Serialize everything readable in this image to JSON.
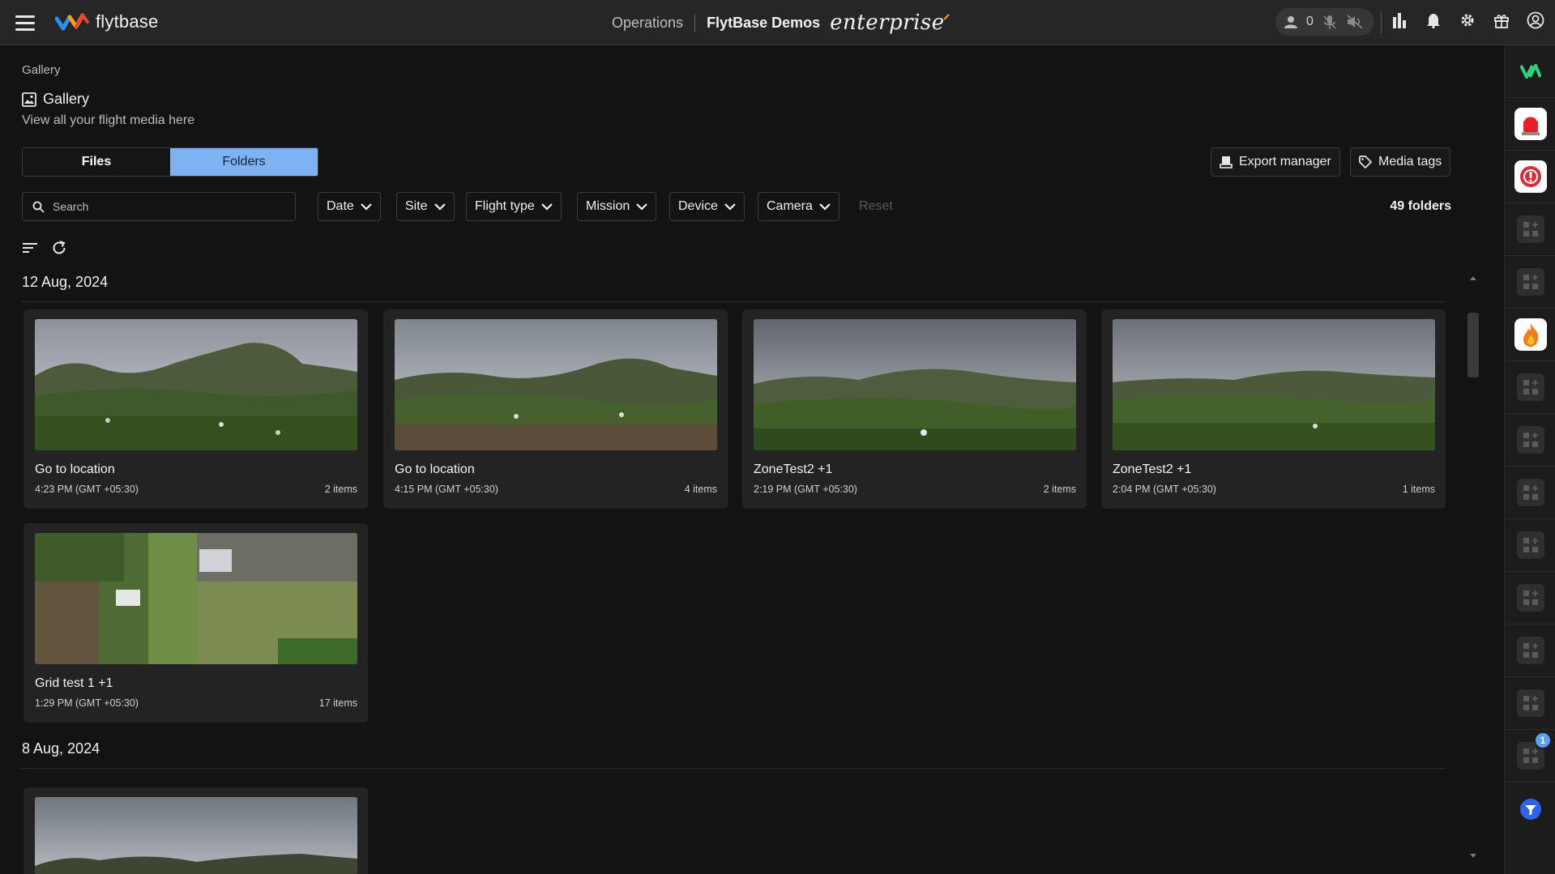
{
  "topbar": {
    "logo_text": "flytbase",
    "operations": "Operations",
    "org_name": "FlytBase Demos",
    "edition": "enterprise",
    "user_count": "0"
  },
  "page": {
    "breadcrumb": "Gallery",
    "title": "Gallery",
    "subtitle": "View all your flight media here"
  },
  "view_toggle": {
    "files": "Files",
    "folders": "Folders",
    "active": "Folders"
  },
  "actions": {
    "export_manager": "Export manager",
    "media_tags": "Media tags"
  },
  "search": {
    "placeholder": "Search",
    "value": ""
  },
  "filters": {
    "date": "Date",
    "site": "Site",
    "flight_type": "Flight type",
    "mission": "Mission",
    "device": "Device",
    "camera": "Camera",
    "reset": "Reset"
  },
  "folder_count": "49 folders",
  "groups": [
    {
      "date": "12 Aug, 2024",
      "folders": [
        {
          "name": "Go to location",
          "time": "4:23 PM (GMT +05:30)",
          "items": "2 items"
        },
        {
          "name": "Go to location",
          "time": "4:15 PM (GMT +05:30)",
          "items": "4 items"
        },
        {
          "name": "ZoneTest2 +1",
          "time": "2:19 PM (GMT +05:30)",
          "items": "2 items"
        },
        {
          "name": "ZoneTest2 +1",
          "time": "2:04 PM (GMT +05:30)",
          "items": "1 items"
        },
        {
          "name": "Grid test 1 +1",
          "time": "1:29 PM (GMT +05:30)",
          "items": "17 items"
        }
      ]
    },
    {
      "date": "8 Aug, 2024",
      "folders": []
    }
  ],
  "rightbar": {
    "notification_badge": "1"
  },
  "colors": {
    "accent": "#7fb2f0",
    "background": "#131313",
    "card": "#232323",
    "topbar": "#262626"
  }
}
